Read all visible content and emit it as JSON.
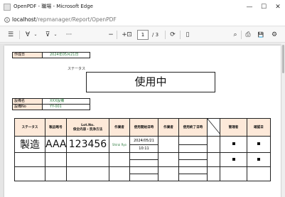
{
  "window": {
    "title": "OpenPDF - 職場 - Microsoft Edge",
    "minimize": "—",
    "maximize": "☐",
    "close": "✕"
  },
  "address": {
    "host": "localhost",
    "path": "/repmanager/Report/OpenPDF"
  },
  "toolbar": {
    "contents_icon": "☰",
    "draw_icon": "∀",
    "erase_icon": "⊽",
    "more_icon": "···",
    "zoom_out": "−",
    "zoom_in": "+",
    "fit_icon": "⊡",
    "page_current": "1",
    "page_total": "/ 3",
    "rotate_icon": "⟳",
    "view_icon": "▯",
    "search_icon": "⌕",
    "print_icon": "⎙",
    "save_icon": "💾",
    "settings_icon": "⚙"
  },
  "doc": {
    "created_label": "作成日",
    "created_value": "2024年05月21日",
    "status_caption": "ステータス",
    "status_value": "使用中",
    "equipment_label": "設備名",
    "equipment_value": "XXX設備",
    "equipment_no_label": "設備No",
    "equipment_no_value": "YY-001",
    "columns": [
      "ステータス",
      "製品略号",
      "Lot.No.\n保全内容・洗浄方法",
      "作業者",
      "使用開始日時",
      "作業者",
      "使用終了日時",
      "",
      "管理者",
      "確認日"
    ],
    "row1": {
      "status": "製造",
      "product": "AAA",
      "lot": "123456",
      "worker": "Shirai Ryo",
      "start_date": "2024/05/21",
      "start_time": "10:11"
    }
  }
}
